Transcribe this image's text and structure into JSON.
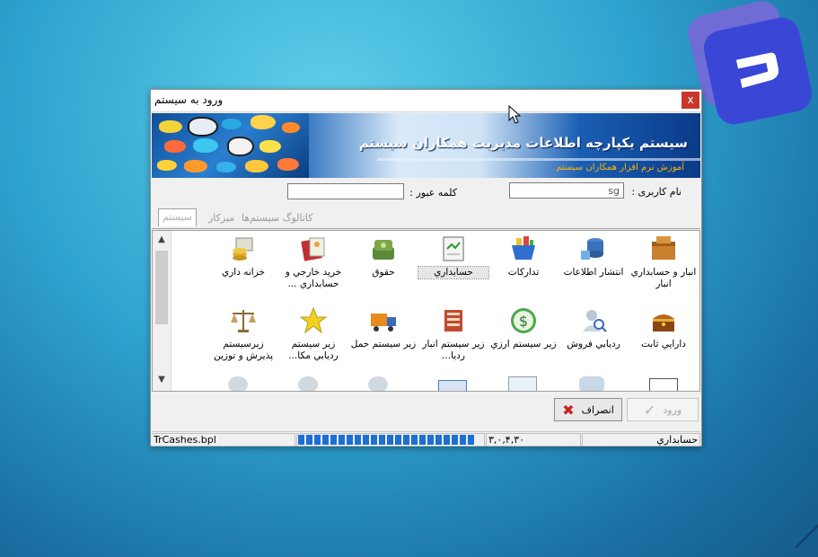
{
  "window": {
    "title": "ورود به سیستم",
    "close_label": "x"
  },
  "banner": {
    "title": "سیستم یکپارچه اطلاعات مدیریت همکاران سیستم",
    "subtitle": "آموزش نرم افزار همکاران سیستم"
  },
  "login": {
    "username_label": "نام کاربری :",
    "username_value": "sg",
    "password_label": "کلمه عبور :",
    "password_value": ""
  },
  "tabs": [
    {
      "label": "سیستم",
      "active": true
    },
    {
      "label": "میزکار",
      "active": false
    },
    {
      "label": "کاتالوگ سیستم‌ها",
      "active": false
    }
  ],
  "items": [
    {
      "label": "انبار و حسابداري انبار",
      "icon": "boxes-icon"
    },
    {
      "label": "انتشار اطلاعات",
      "icon": "database-network-icon"
    },
    {
      "label": "تدارکات",
      "icon": "shopping-basket-icon"
    },
    {
      "label": "حسابداري",
      "icon": "ledger-icon",
      "selected": true
    },
    {
      "label": "حقوق",
      "icon": "money-stack-icon"
    },
    {
      "label": "خريد خارجي و حسابداري ...",
      "icon": "passport-card-icon"
    },
    {
      "label": "خزانه داري",
      "icon": "coins-card-icon"
    },
    {
      "label": "دارايي ثابت",
      "icon": "treasure-chest-icon"
    },
    {
      "label": "رديابي فروش",
      "icon": "search-person-icon"
    },
    {
      "label": "زير سيستم ارزي",
      "icon": "dollar-icon"
    },
    {
      "label": "زير سيستم انبار رديا...",
      "icon": "book-stack-icon"
    },
    {
      "label": "زير سيستم حمل",
      "icon": "truck-icon"
    },
    {
      "label": "زير سيستم رديابي مکا...",
      "icon": "star-icon"
    },
    {
      "label": "زيرسيستم پذيرش و توزين",
      "icon": "scale-icon"
    }
  ],
  "buttons": {
    "login_label": "ورود",
    "cancel_label": "انصراف"
  },
  "status": {
    "file": "TrCashes.bpl",
    "progress": 0.97,
    "version": "۳,۰,۴,۳۰",
    "system": "حسابداري"
  },
  "colors": {
    "accent": "#1c6fd6",
    "close": "#c9352c",
    "banner_sub": "#ffb300"
  }
}
